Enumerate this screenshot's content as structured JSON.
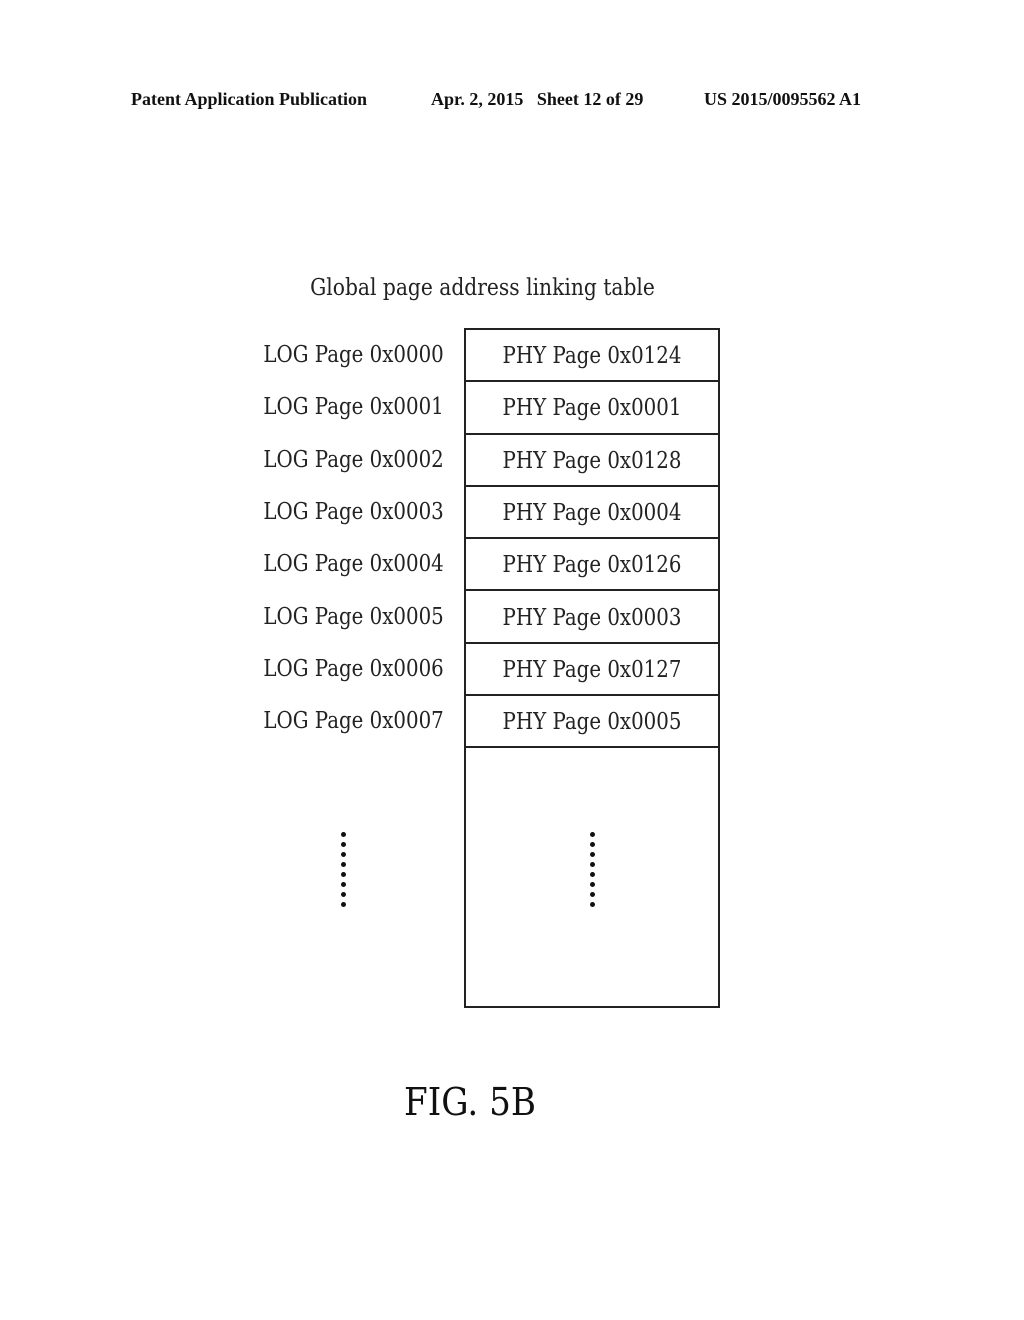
{
  "header": {
    "publication": "Patent Application Publication",
    "date_sheet": "Apr. 2, 2015   Sheet 12 of 29",
    "patent_number": "US 2015/0095562 A1"
  },
  "figure": {
    "title": "Global page address linking table",
    "rows": [
      {
        "log": "LOG Page 0x0000",
        "phy": "PHY Page 0x0124"
      },
      {
        "log": "LOG Page 0x0001",
        "phy": "PHY Page 0x0001"
      },
      {
        "log": "LOG Page 0x0002",
        "phy": "PHY Page 0x0128"
      },
      {
        "log": "LOG Page 0x0003",
        "phy": "PHY Page 0x0004"
      },
      {
        "log": "LOG Page 0x0004",
        "phy": "PHY Page 0x0126"
      },
      {
        "log": "LOG Page 0x0005",
        "phy": "PHY Page 0x0003"
      },
      {
        "log": "LOG Page 0x0006",
        "phy": "PHY Page 0x0127"
      },
      {
        "log": "LOG Page 0x0007",
        "phy": "PHY Page 0x0005"
      }
    ],
    "continuation": "vertical-ellipsis",
    "caption": "FIG. 5B"
  }
}
